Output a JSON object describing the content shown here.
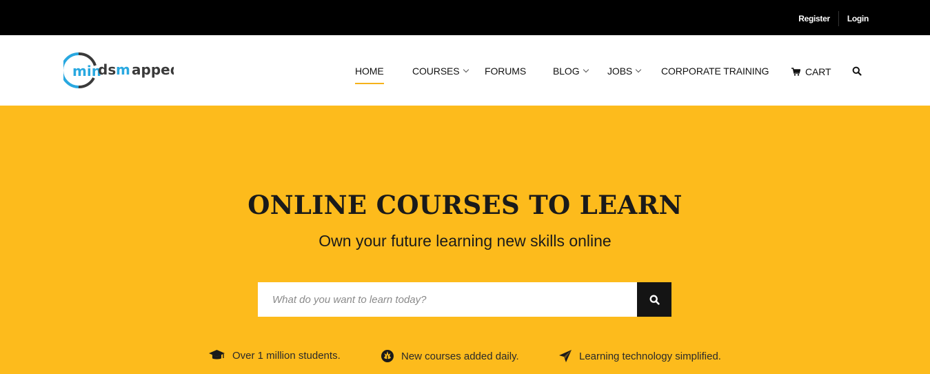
{
  "topbar": {
    "register": "Register",
    "login": "Login"
  },
  "logo": {
    "text": "mindsmapped",
    "colors": {
      "ring": "#29a8e0",
      "dark": "#3a3a3a"
    }
  },
  "nav": {
    "home": "HOME",
    "courses": "COURSES",
    "forums": "FORUMS",
    "blog": "BLOG",
    "jobs": "JOBS",
    "corporate": "CORPORATE TRAINING",
    "cart": "CART",
    "active_underline_color": "#f6b21a",
    "icons": {
      "cart": "cart-icon",
      "search": "search-icon"
    }
  },
  "hero": {
    "title": "ONLINE COURSES TO LEARN",
    "subtitle": "Own your future learning new skills online",
    "background": "#fdbb1c",
    "search": {
      "placeholder": "What do you want to learn today?",
      "value": "",
      "button_icon": "search-icon"
    },
    "features": [
      {
        "icon": "graduation-cap-icon",
        "text": "Over 1 million students."
      },
      {
        "icon": "rebel-icon",
        "text": "New courses added daily."
      },
      {
        "icon": "paper-plane-icon",
        "text": "Learning technology simplified."
      }
    ]
  }
}
